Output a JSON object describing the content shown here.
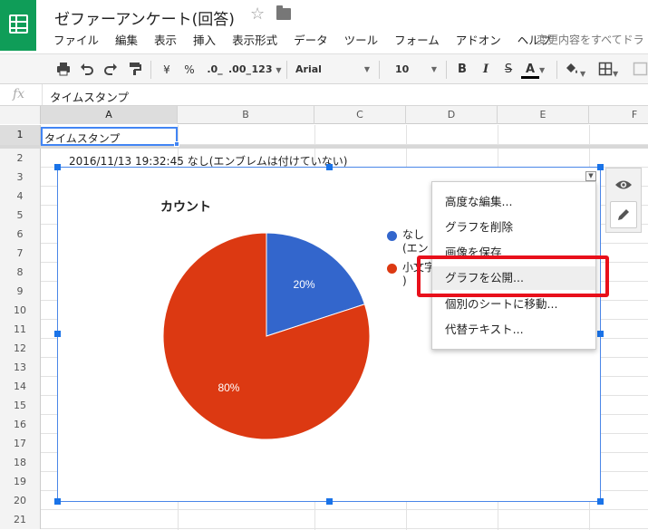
{
  "header": {
    "doc_title": "ゼファーアンケート(回答)",
    "save_status": "変更内容をすべてドラ"
  },
  "menubar": {
    "items": [
      "ファイル",
      "編集",
      "表示",
      "挿入",
      "表示形式",
      "データ",
      "ツール",
      "フォーム",
      "アドオン",
      "ヘルプ"
    ]
  },
  "toolbar": {
    "currency": "¥",
    "percent": "%",
    "decrease_decimals": ".0_",
    "increase_decimals": ".00_",
    "number_format": "123",
    "font_name": "Arial",
    "font_size": "10",
    "bold": "B",
    "italic": "I",
    "strike": "S",
    "text_color": "A"
  },
  "formula_bar": {
    "fx": "fx",
    "value": "タイムスタンプ"
  },
  "grid": {
    "columns": [
      "A",
      "B",
      "C",
      "D",
      "E",
      "F"
    ],
    "rows": [
      "1",
      "2",
      "3",
      "4",
      "5",
      "6",
      "7",
      "8",
      "9",
      "10",
      "11",
      "12",
      "13",
      "14",
      "15",
      "16",
      "17",
      "18",
      "19",
      "20",
      "21"
    ],
    "a1": "タイムスタンプ",
    "row2_text": "2016/11/13 19:32:45  なし(エンブレムは付けていない)"
  },
  "chart": {
    "title": "カウント",
    "legend": [
      {
        "line1": "なし",
        "line2": "(エン"
      },
      {
        "line1": "小文字",
        "line2": ")"
      }
    ]
  },
  "chart_data": {
    "type": "pie",
    "title": "カウント",
    "categories": [
      "なし(エンブレムは付けていない)",
      "小文字"
    ],
    "values": [
      20,
      80
    ],
    "labels": [
      "20%",
      "80%"
    ],
    "colors": [
      "#3366cc",
      "#dc3912"
    ],
    "legend_position": "right"
  },
  "context_menu": {
    "items": [
      "高度な編集...",
      "グラフを削除",
      "画像を保存",
      "グラフを公開...",
      "個別のシートに移動...",
      "代替テキスト..."
    ]
  },
  "colors": {
    "brand_green": "#0f9d58",
    "selection_blue": "#4285f4",
    "highlight_red": "#e8101b"
  }
}
